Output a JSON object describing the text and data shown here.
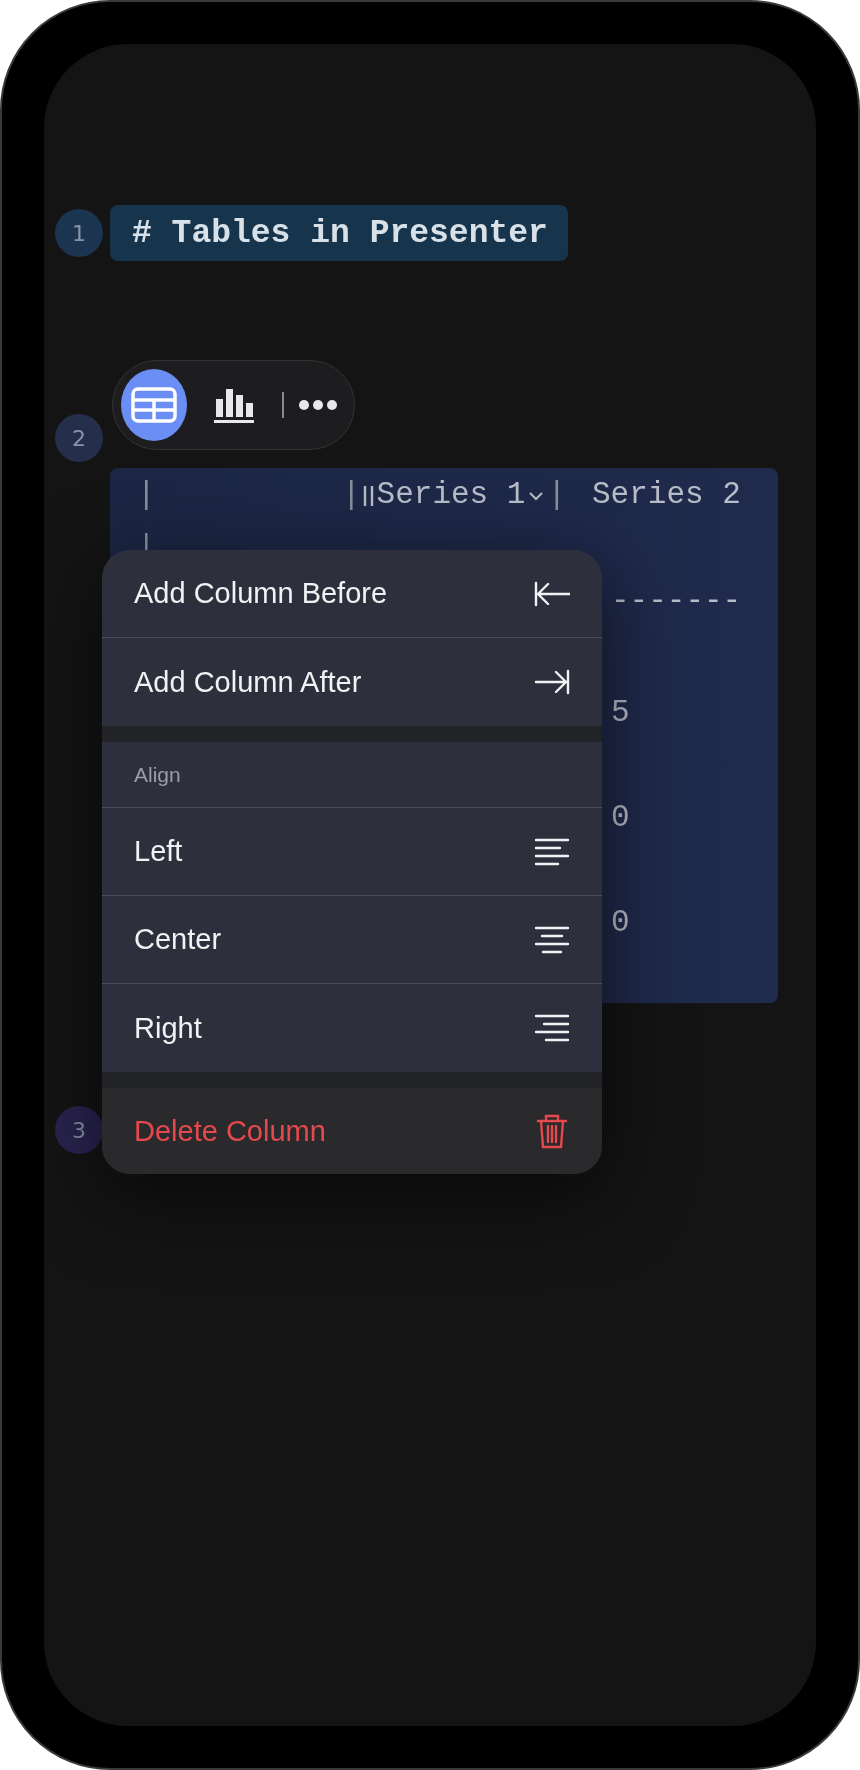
{
  "editor": {
    "lines": [
      {
        "number": "1",
        "color": "#1b3550",
        "kind": "heading",
        "text": "# Tables in Presenter"
      },
      {
        "number": "2",
        "color": "#252e4a",
        "kind": "table"
      },
      {
        "number": "3",
        "color": "#2a2450",
        "kind": "empty"
      }
    ]
  },
  "toolbar": {
    "buttons": [
      {
        "kind": "table",
        "selected": true
      },
      {
        "kind": "chart",
        "selected": false
      },
      {
        "kind": "more",
        "selected": false
      }
    ]
  },
  "table": {
    "rows": [
      {
        "kind": "header",
        "cells": [
          "|",
          "|",
          "Series 1",
          "|",
          "Series 2"
        ]
      },
      {
        "kind": "pipe",
        "cells": [
          "|"
        ]
      },
      {
        "kind": "rule",
        "cells": [
          "-------"
        ]
      },
      {
        "kind": "value",
        "cells": [
          "5"
        ]
      },
      {
        "kind": "value",
        "cells": [
          "0"
        ]
      },
      {
        "kind": "value",
        "cells": [
          "0"
        ]
      }
    ]
  },
  "context_menu": {
    "sections": [
      {
        "items": [
          {
            "label": "Add Column Before",
            "kind": "insert-before"
          },
          {
            "label": "Add Column After",
            "kind": "insert-after"
          }
        ]
      },
      {
        "header": "Align",
        "items": [
          {
            "label": "Left",
            "kind": "align-left"
          },
          {
            "label": "Center",
            "kind": "align-center"
          },
          {
            "label": "Right",
            "kind": "align-right"
          }
        ]
      },
      {
        "items": [
          {
            "label": "Delete Column",
            "kind": "delete"
          }
        ]
      }
    ]
  }
}
